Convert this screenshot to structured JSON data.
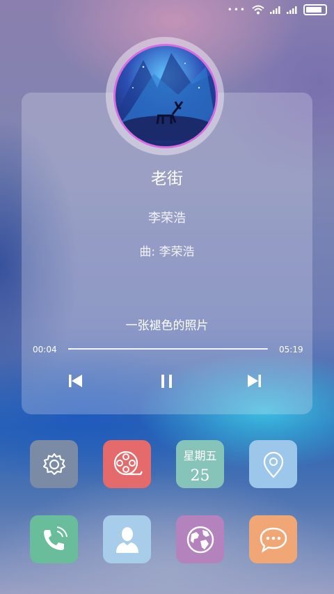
{
  "status_bar": {
    "icons": [
      "dots-icon",
      "wifi-icon",
      "signal-icon",
      "signal-icon",
      "battery-icon"
    ],
    "battery_level": 0.85
  },
  "player": {
    "song_title": "老街",
    "artist": "李荣浩",
    "composer_line": "曲: 李荣浩",
    "lyric_line": "一张褪色的照片",
    "elapsed": "00:04",
    "total": "05:19",
    "progress": 0.013,
    "controls": [
      "previous-icon",
      "pause-icon",
      "next-icon"
    ]
  },
  "home_apps": {
    "row1": [
      {
        "name": "settings",
        "icon": "gear-icon",
        "color": "#7b8aa5"
      },
      {
        "name": "video",
        "icon": "film-reel-icon",
        "color": "#e46a6b"
      },
      {
        "name": "calendar",
        "icon": "calendar-icon",
        "color": "#86c4b9",
        "day": "星期五",
        "date": "25"
      },
      {
        "name": "location",
        "icon": "location-pin-icon",
        "color": "#9cc6ea"
      }
    ],
    "row2": [
      {
        "name": "phone",
        "icon": "phone-icon",
        "color": "#69bd9a"
      },
      {
        "name": "contacts",
        "icon": "person-icon",
        "color": "#a7cdeb"
      },
      {
        "name": "browser",
        "icon": "globe-icon",
        "color": "#b483bd"
      },
      {
        "name": "messages",
        "icon": "chat-bubble-icon",
        "color": "#f1a775"
      }
    ]
  }
}
